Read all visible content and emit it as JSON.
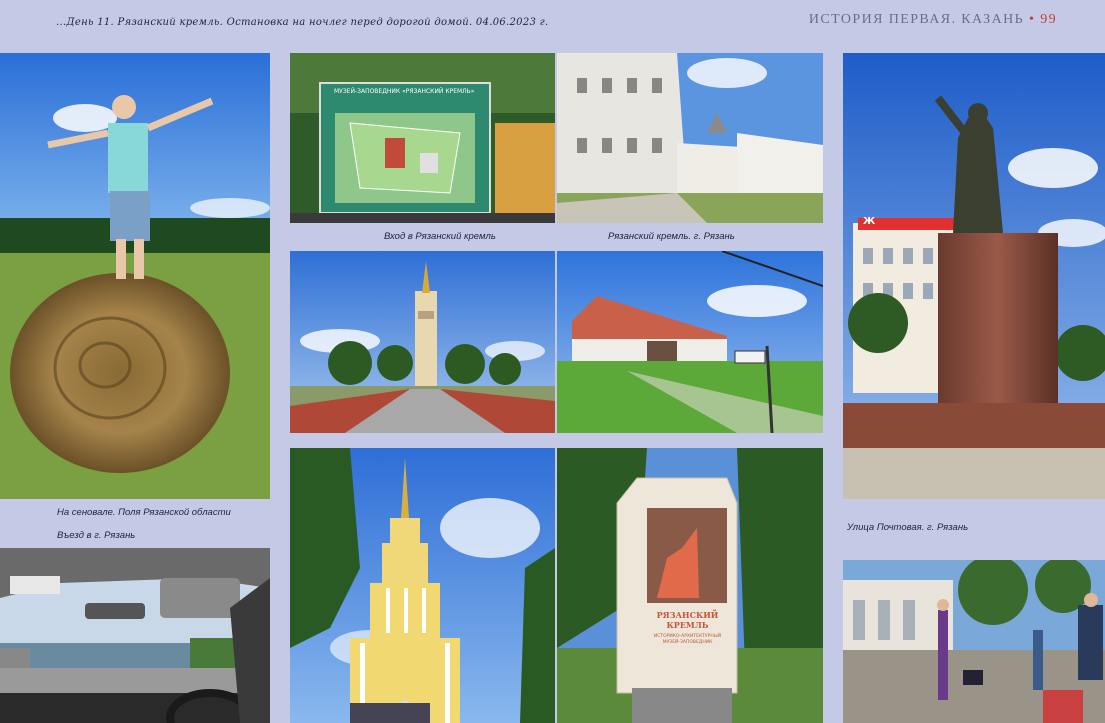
{
  "header": {
    "left_text": "...День 11. Рязанский кремль. Остановка на ночлег перед дорогой домой. 04.06.2023 г.",
    "section_title": "ИСТОРИЯ ПЕРВАЯ. КАЗАНЬ",
    "separator": "•",
    "page_number": "99"
  },
  "captions": {
    "hay": "На сеновале. Поля Рязанской области",
    "car": "Въезд в г. Рязань",
    "entrance": "Вход в Рязанский кремль",
    "kremlin": "Рязанский кремль. г. Рязань",
    "pochtovaya": "Улица Почтовая. г. Рязань"
  },
  "photo_texts": {
    "map_sign": "МУЗЕЙ-ЗАПОВЕДНИК «РЯЗАНСКИЙ КРЕМЛЬ»",
    "store_sign": "Ж",
    "monument_title_line1": "РЯЗАНСКИЙ",
    "monument_title_line2": "КРЕМЛЬ",
    "monument_sub": "ИСТОРИКО-АРХИТЕКТУРНЫЙ МУЗЕЙ-ЗАПОВЕДНИК"
  }
}
